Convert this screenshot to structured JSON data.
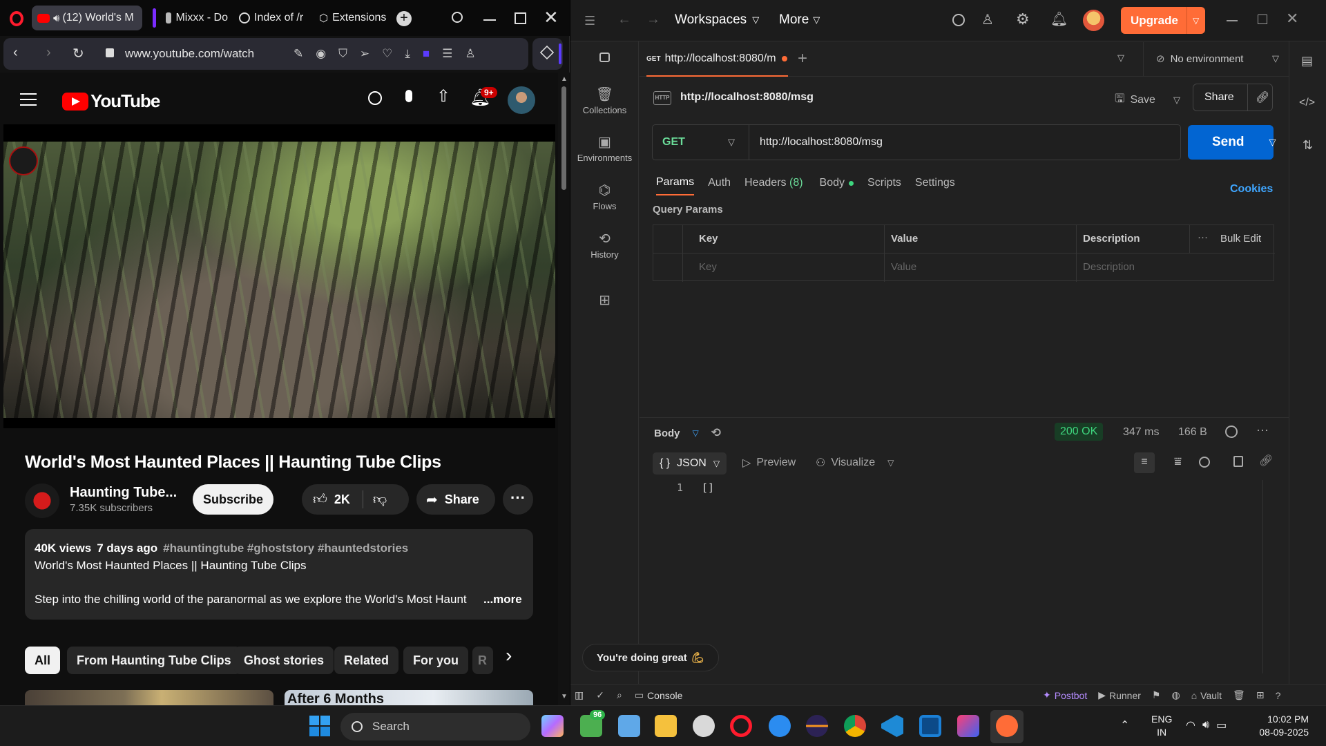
{
  "browser": {
    "tabs": [
      {
        "label": "(12) World's M"
      },
      {
        "label": "Mixxx - Do"
      },
      {
        "label": "Index of /r"
      },
      {
        "label": "Extensions"
      }
    ],
    "url": "www.youtube.com/watch"
  },
  "youtube": {
    "logo_text": "YouTube",
    "notif_badge": "9+",
    "video_title": "World's Most Haunted Places || Haunting Tube Clips",
    "channel_name": "Haunting Tube...",
    "subscribers": "7.35K subscribers",
    "subscribe_label": "Subscribe",
    "likes": "2K",
    "share_label": "Share",
    "desc_views": "40K views",
    "desc_date": "7 days ago",
    "desc_tags": "#hauntingtube #ghoststory #hauntedstories",
    "desc_line1": "World's Most Haunted Places  || Haunting Tube Clips",
    "desc_line2": "Step into the chilling world of the paranormal as we explore the World's Most Haunt",
    "more_label": "...more",
    "chips": [
      "All",
      "From Haunting Tube Clips",
      "Ghost stories",
      "Related",
      "For you",
      "R"
    ],
    "thumb_caption": "After 6 Months"
  },
  "postman": {
    "nav": {
      "workspaces": "Workspaces",
      "more": "More",
      "upgrade": "Upgrade"
    },
    "tab": {
      "method": "GET",
      "label": "http://localhost:8080/m"
    },
    "environment": "No environment",
    "request_name": "http://localhost:8080/msg",
    "save_label": "Save",
    "share_label": "Share",
    "method": "GET",
    "url": "http://localhost:8080/msg",
    "send_label": "Send",
    "side": [
      "Collections",
      "Environments",
      "Flows",
      "History"
    ],
    "req_tabs": {
      "params": "Params",
      "auth": "Auth",
      "headers": "Headers",
      "headers_count": "(8)",
      "body": "Body",
      "scripts": "Scripts",
      "settings": "Settings"
    },
    "cookies": "Cookies",
    "query_params": "Query Params",
    "table": {
      "key": "Key",
      "value": "Value",
      "description": "Description",
      "bulk_edit": "Bulk Edit",
      "key_ph": "Key",
      "value_ph": "Value",
      "desc_ph": "Description"
    },
    "response": {
      "body_label": "Body",
      "status": "200 OK",
      "time": "347 ms",
      "size": "166 B",
      "format": "JSON",
      "preview": "Preview",
      "visualize": "Visualize",
      "line_no": "1",
      "content": "[]"
    },
    "toast": "You're doing great",
    "status_bar": {
      "console": "Console",
      "postbot": "Postbot",
      "runner": "Runner",
      "vault": "Vault"
    }
  },
  "taskbar": {
    "search": "Search",
    "lang1": "ENG",
    "lang2": "IN",
    "time": "10:02 PM",
    "date": "08-09-2025",
    "badge": "96"
  }
}
